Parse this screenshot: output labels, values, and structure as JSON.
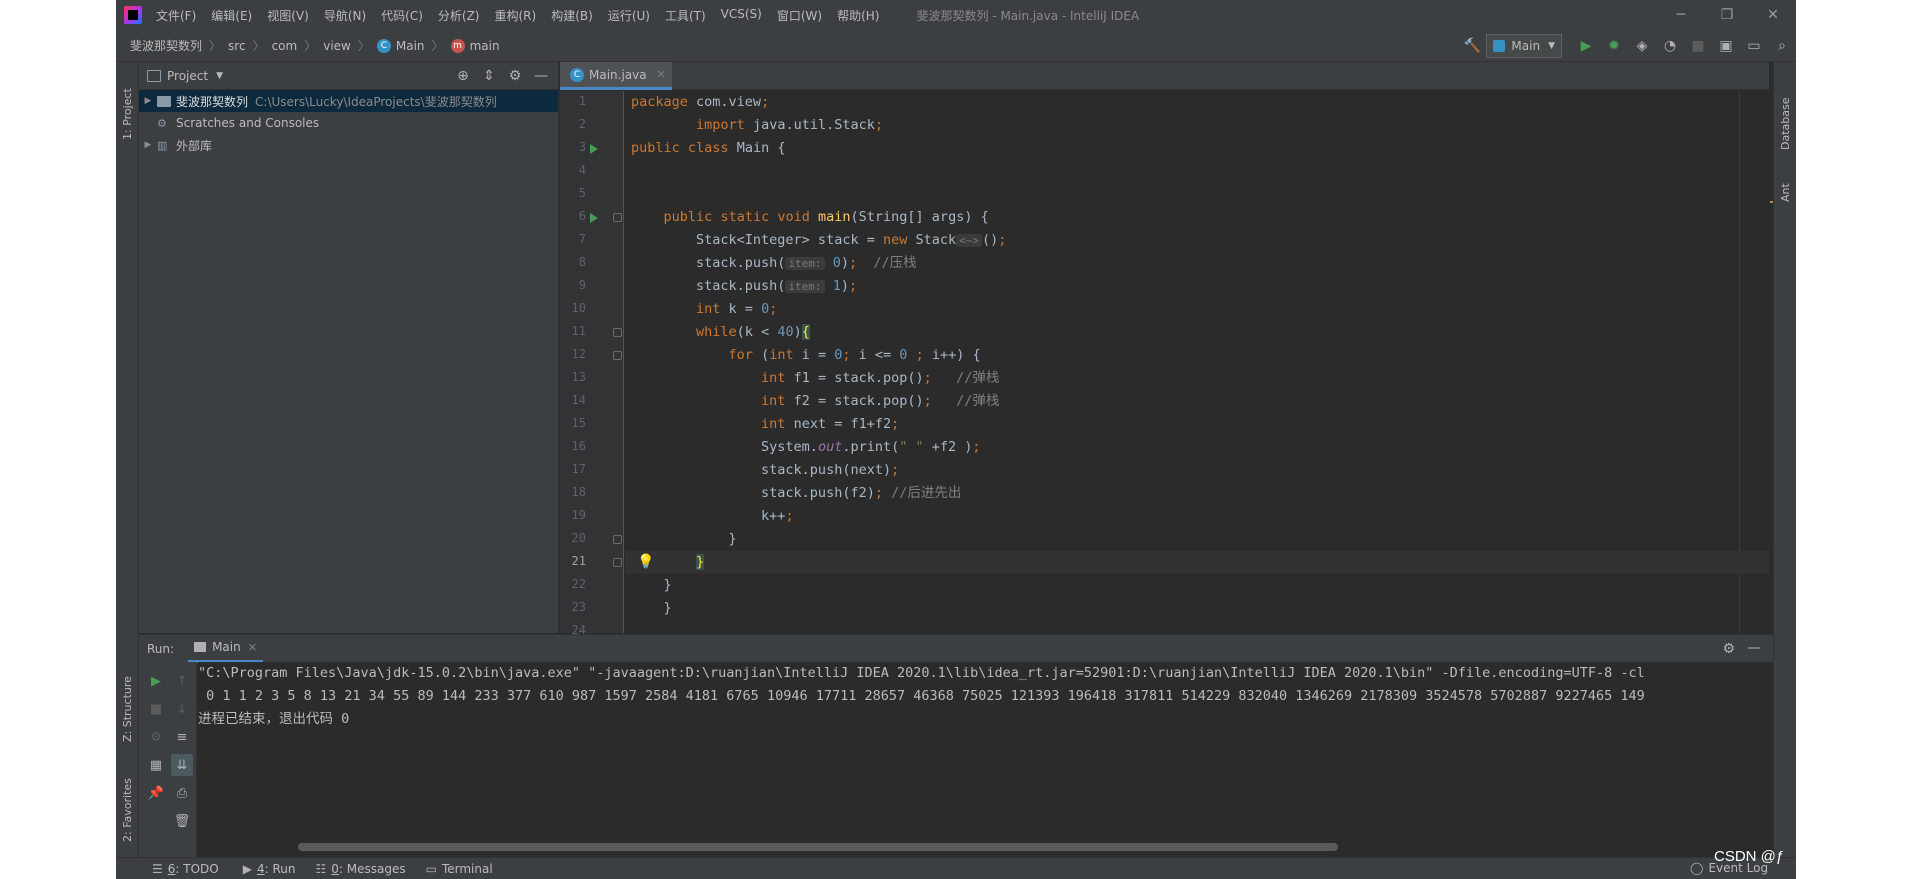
{
  "window": {
    "menu": [
      "文件(F)",
      "编辑(E)",
      "视图(V)",
      "导航(N)",
      "代码(C)",
      "分析(Z)",
      "重构(R)",
      "构建(B)",
      "运行(U)",
      "工具(T)",
      "VCS(S)",
      "窗口(W)",
      "帮助(H)"
    ],
    "title": "斐波那契数列 - Main.java - IntelliJ IDEA"
  },
  "breadcrumb": [
    "斐波那契数列",
    "src",
    "com",
    "view",
    "Main",
    "main"
  ],
  "run_config": "Main",
  "left_stripe": {
    "project": "1: Project",
    "structure": "Z: Structure",
    "favorites": "2: Favorites"
  },
  "right_stripe": {
    "database": "Database",
    "ant": "Ant"
  },
  "project_panel": {
    "title": "Project",
    "tree": [
      {
        "label": "斐波那契数列",
        "path": "C:\\Users\\Lucky\\IdeaProjects\\斐波那契数列"
      },
      {
        "label": "Scratches and Consoles"
      },
      {
        "label": "外部库"
      }
    ]
  },
  "editor": {
    "tab": "Main.java",
    "current_line": 21,
    "line_numbers": [
      "1",
      "2",
      "3",
      "4",
      "5",
      "6",
      "7",
      "8",
      "9",
      "10",
      "11",
      "12",
      "13",
      "14",
      "15",
      "16",
      "17",
      "18",
      "19",
      "20",
      "21",
      "22",
      "23",
      "24"
    ],
    "lines": [
      "package com.view;",
      "        import java.util.Stack;",
      "public class Main {",
      "",
      "",
      "    public static void main(String[] args) {",
      "        Stack<Integer> stack = new Stack<~>();",
      "        stack.push( item: 0);  //压栈",
      "        stack.push( item: 1);",
      "        int k = 0;",
      "        while(k < 40){",
      "            for (int i = 0; i <= 0 ; i++) {",
      "                int f1 = stack.pop();   //弹栈",
      "                int f2 = stack.pop();   //弹栈",
      "                int next = f1+f2;",
      "                System.out.print(\" \" +f2 );",
      "                stack.push(next);",
      "                stack.push(f2); //后进先出",
      "                k++;",
      "            }",
      "        }",
      "    }",
      "    }",
      ""
    ]
  },
  "run": {
    "label": "Run:",
    "tab": "Main",
    "output": [
      "\"C:\\Program Files\\Java\\jdk-15.0.2\\bin\\java.exe\" \"-javaagent:D:\\ruanjian\\IntelliJ IDEA 2020.1\\lib\\idea_rt.jar=52901:D:\\ruanjian\\IntelliJ IDEA 2020.1\\bin\" -Dfile.encoding=UTF-8 -cl",
      " 0 1 1 2 3 5 8 13 21 34 55 89 144 233 377 610 987 1597 2584 4181 6765 10946 17711 28657 46368 75025 121393 196418 317811 514229 832040 1346269 2178309 3524578 5702887 9227465 149",
      "进程已结束，退出代码 0"
    ]
  },
  "statusbar": {
    "todo": {
      "num": "6",
      "label": ": TODO"
    },
    "run": {
      "num": "4",
      "label": ": Run"
    },
    "messages": {
      "num": "0",
      "label": ": Messages"
    },
    "terminal": "Terminal",
    "event_log": "Event Log"
  },
  "watermark": "CSDN @ƒ",
  "colors": {
    "keyword": "#cc7832",
    "number": "#6897bb",
    "string": "#6a8759",
    "comment": "#808080",
    "method": "#ffc66d",
    "field": "#9876aa",
    "selection": "#0d293e",
    "accent": "#4a88c7"
  }
}
